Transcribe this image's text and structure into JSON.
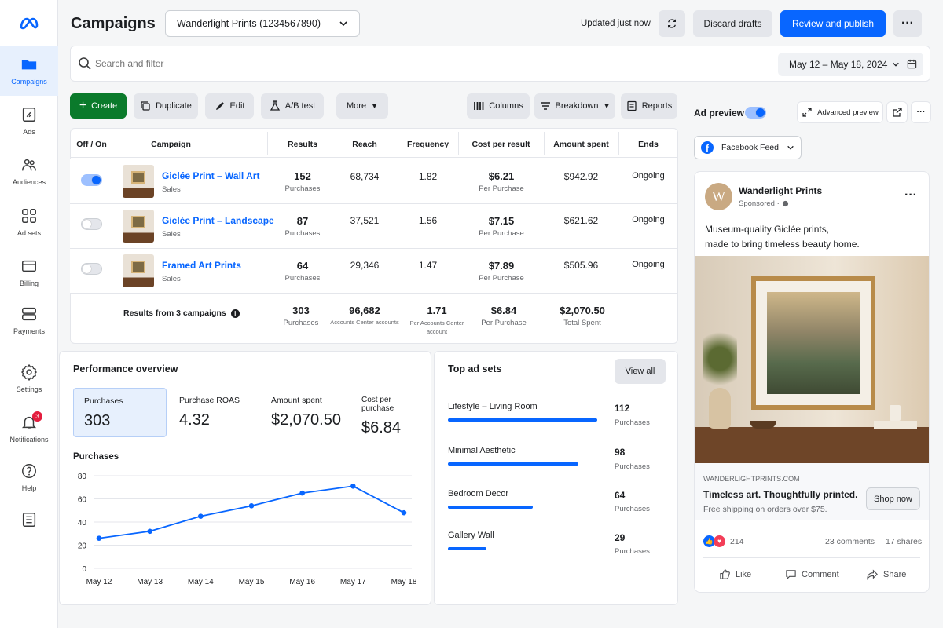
{
  "sidebar": {
    "items": [
      {
        "label": "Campaigns",
        "icon": "folder-icon"
      },
      {
        "label": "Ads",
        "icon": "ads-icon"
      },
      {
        "label": "Audiences",
        "icon": "audiences-icon"
      },
      {
        "label": "Ad sets",
        "icon": "grid-icon"
      },
      {
        "label": "Billing",
        "icon": "billing-icon"
      },
      {
        "label": "Payments",
        "icon": "payments-icon"
      },
      {
        "label": "Settings",
        "icon": "gear-icon"
      },
      {
        "label": "Notifications",
        "icon": "bell-icon",
        "badge": "3"
      },
      {
        "label": "Help",
        "icon": "help-icon"
      }
    ]
  },
  "header": {
    "title": "Campaigns",
    "account": "Wanderlight Prints (1234567890)",
    "updated": "Updated just now",
    "discard": "Discard drafts",
    "publish": "Review and publish"
  },
  "search": {
    "placeholder": "Search and filter",
    "date_range": "May 12 – May 18, 2024"
  },
  "toolbar": {
    "create": "Create",
    "duplicate": "Duplicate",
    "edit": "Edit",
    "ab": "A/B test",
    "more": "More",
    "columns": "Columns",
    "breakdown": "Breakdown",
    "reports": "Reports"
  },
  "table": {
    "headers": [
      "Off / On",
      "Campaign",
      "Results",
      "Reach",
      "Frequency",
      "Cost per result",
      "Amount spent",
      "Ends"
    ],
    "rows": [
      {
        "on": true,
        "name": "Giclée Print – Wall Art",
        "type": "Sales",
        "results": "152",
        "results_label": "Purchases",
        "reach": "68,734",
        "frequency": "1.82",
        "cost": "$6.21",
        "cost_label": "Per Purchase",
        "spent": "$942.92",
        "ends": "Ongoing"
      },
      {
        "on": false,
        "name": "Giclée Print – Landscape",
        "type": "Sales",
        "results": "87",
        "results_label": "Purchases",
        "reach": "37,521",
        "frequency": "1.56",
        "cost": "$7.15",
        "cost_label": "Per Purchase",
        "spent": "$621.62",
        "ends": "Ongoing"
      },
      {
        "on": false,
        "name": "Framed Art Prints",
        "type": "Sales",
        "results": "64",
        "results_label": "Purchases",
        "reach": "29,346",
        "frequency": "1.47",
        "cost": "$7.89",
        "cost_label": "Per Purchase",
        "spent": "$505.96",
        "ends": "Ongoing"
      }
    ],
    "totals": {
      "label": "Results from 3 campaigns",
      "results": "303",
      "results_label": "Purchases",
      "reach": "96,682",
      "reach_label": "Accounts Center accounts",
      "frequency": "1.71",
      "frequency_label": "Per Accounts Center account",
      "cost": "$6.84",
      "cost_label": "Per Purchase",
      "spent": "$2,070.50",
      "spent_label": "Total Spent"
    }
  },
  "performance": {
    "title": "Performance overview",
    "kpis": [
      {
        "label": "Purchases",
        "value": "303"
      },
      {
        "label": "Purchase ROAS",
        "value": "4.32"
      },
      {
        "label": "Amount spent",
        "value": "$2,070.50"
      },
      {
        "label": "Cost per purchase",
        "value": "$6.84"
      }
    ],
    "chart_title": "Purchases"
  },
  "chart_data": {
    "type": "line",
    "title": "Purchases",
    "categories": [
      "May 12",
      "May 13",
      "May 14",
      "May 15",
      "May 16",
      "May 17",
      "May 18"
    ],
    "values": [
      26,
      32,
      45,
      54,
      65,
      71,
      48
    ],
    "yticks": [
      0,
      20,
      40,
      60,
      80
    ],
    "ylim": [
      0,
      80
    ],
    "grid": true,
    "color": "#0866ff"
  },
  "adsets": {
    "title": "Top ad sets",
    "view_all": "View all",
    "items": [
      {
        "name": "Lifestyle – Living Room",
        "value": "112",
        "label": "Purchases",
        "fill": 1.0
      },
      {
        "name": "Minimal Aesthetic",
        "value": "98",
        "label": "Purchases",
        "fill": 0.875
      },
      {
        "name": "Bedroom Decor",
        "value": "64",
        "label": "Purchases",
        "fill": 0.571
      },
      {
        "name": "Gallery Wall",
        "value": "29",
        "label": "Purchases",
        "fill": 0.259
      }
    ]
  },
  "preview": {
    "label": "Ad preview",
    "advanced": "Advanced preview",
    "placement": "Facebook Feed",
    "page_name": "Wanderlight Prints",
    "avatar": "W",
    "sponsored": "Sponsored ·",
    "body_line1": "Museum-quality Giclée prints,",
    "body_line2": "made to bring timeless beauty home.",
    "domain": "WANDERLIGHTPRINTS.COM",
    "headline": "Timeless art. Thoughtfully printed.",
    "description": "Free shipping on orders over $75.",
    "cta": "Shop now",
    "reactions": "214",
    "comments": "23 comments",
    "shares": "17 shares",
    "like": "Like",
    "comment": "Comment",
    "share": "Share"
  },
  "colors": {
    "accent": "#0866ff",
    "create": "#0a7a2b"
  }
}
